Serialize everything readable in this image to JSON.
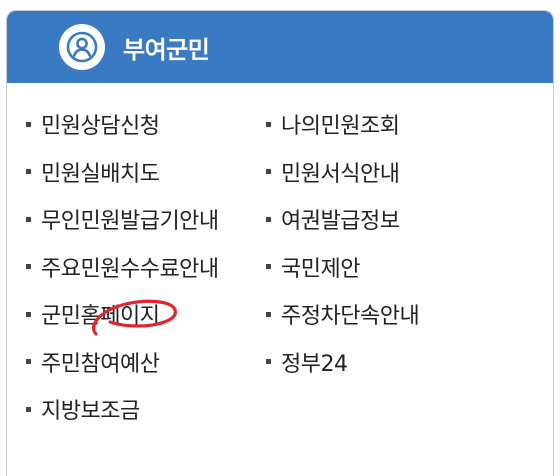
{
  "header": {
    "title": "부여군민",
    "icon": "user-circle-icon",
    "background": "#3a7ac3"
  },
  "menu": {
    "left": [
      "민원상담신청",
      "민원실배치도",
      "무인민원발급기안내",
      "주요민원수수료안내",
      "군민홈페이지",
      "주민참여예산",
      "지방보조금"
    ],
    "right": [
      "나의민원조회",
      "민원서식안내",
      "여권발급정보",
      "국민제안",
      "주정차단속안내",
      "정부24"
    ]
  },
  "annotation": {
    "shape": "red-hand-drawn-circle",
    "color": "#e0262a"
  }
}
